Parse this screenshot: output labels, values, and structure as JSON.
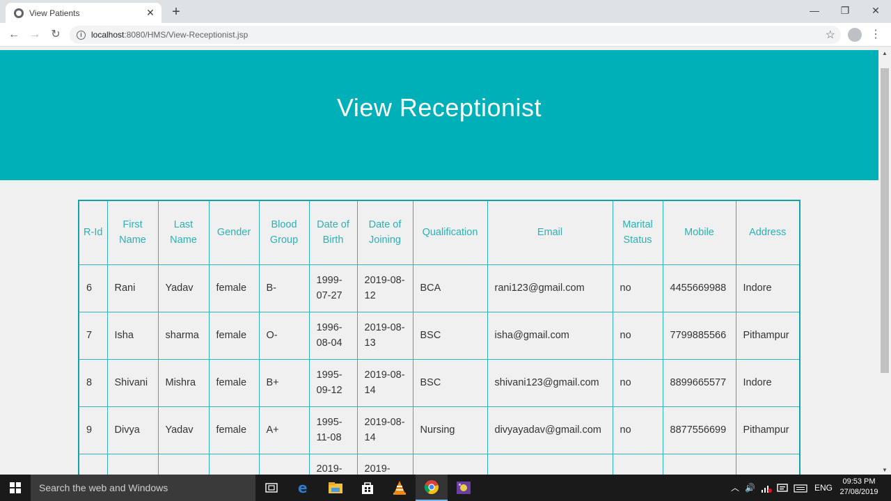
{
  "browser": {
    "tab_title": "View Patients",
    "close_glyph": "✕",
    "new_tab_glyph": "+",
    "url_host": "localhost",
    "url_path": ":8080/HMS/View-Receptionist.jsp",
    "back_glyph": "←",
    "forward_glyph": "→",
    "reload_glyph": "↻",
    "star_glyph": "☆",
    "menu_glyph": "⋮",
    "window_controls": [
      "—",
      "❐",
      "✕"
    ]
  },
  "page": {
    "heading": "View Receptionist",
    "accent_color": "#00b0b9",
    "columns": [
      "R-Id",
      "First Name",
      "Last Name",
      "Gender",
      "Blood Group",
      "Date of Birth",
      "Date of Joining",
      "Qualification",
      "Email",
      "Marital Status",
      "Mobile",
      "Address"
    ],
    "rows": [
      [
        "6",
        "Rani",
        "Yadav",
        "female",
        "B-",
        "1999-07-27",
        "2019-08-12",
        "BCA",
        "rani123@gmail.com",
        "no",
        "4455669988",
        "Indore"
      ],
      [
        "7",
        "Isha",
        "sharma",
        "female",
        "O-",
        "1996-08-04",
        "2019-08-13",
        "BSC",
        "isha@gmail.com",
        "no",
        "7799885566",
        "Pithampur"
      ],
      [
        "8",
        "Shivani",
        "Mishra",
        "female",
        "B+",
        "1995-09-12",
        "2019-08-14",
        "BSC",
        "shivani123@gmail.com",
        "no",
        "8899665577",
        "Indore"
      ],
      [
        "9",
        "Divya",
        "Yadav",
        "female",
        "A+",
        "1995-11-08",
        "2019-08-14",
        "Nursing",
        "divyayadav@gmail.com",
        "no",
        "8877556699",
        "Pithampur"
      ],
      [
        "",
        "",
        "",
        "",
        "",
        "2019-",
        "2019-",
        "",
        "",
        "",
        "",
        ""
      ]
    ]
  },
  "taskbar": {
    "search_placeholder": "Search the web and Windows",
    "language": "ENG",
    "time": "09:53 PM",
    "date": "27/08/2019",
    "icons": [
      "task-view-icon",
      "edge-icon",
      "file-explorer-icon",
      "store-icon",
      "vlc-icon",
      "chrome-icon",
      "app-icon"
    ]
  }
}
